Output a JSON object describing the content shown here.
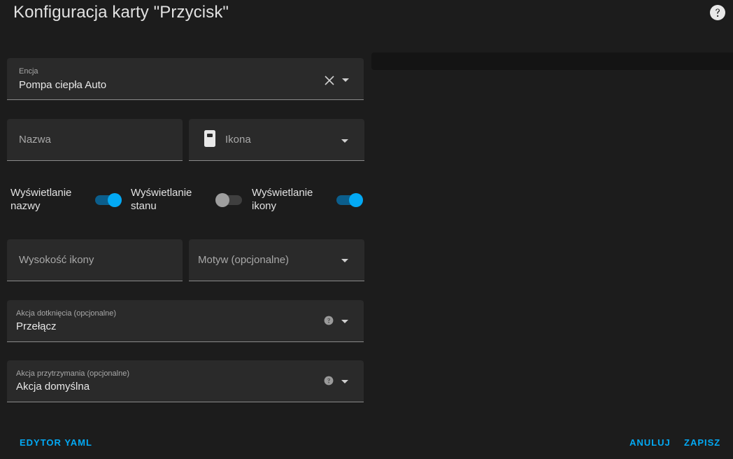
{
  "dialog": {
    "title": "Konfiguracja karty \"Przycisk\"",
    "help_icon": "help-circle-icon"
  },
  "form": {
    "entity": {
      "label": "Encja",
      "value": "Pompa ciepła Auto"
    },
    "name": {
      "placeholder": "Nazwa"
    },
    "icon": {
      "placeholder": "Ikona",
      "icon": "device-icon"
    },
    "toggles": [
      {
        "label": "Wyświetlanie nazwy",
        "on": true
      },
      {
        "label": "Wyświetlanie stanu",
        "on": false
      },
      {
        "label": "Wyświetlanie ikony",
        "on": true
      }
    ],
    "icon_height": {
      "placeholder": "Wysokość ikony"
    },
    "theme": {
      "placeholder": "Motyw (opcjonalne)"
    },
    "tap_action": {
      "label": "Akcja dotknięcia (opcjonalne)",
      "value": "Przełącz"
    },
    "hold_action": {
      "label": "Akcja przytrzymania (opcjonalne)",
      "value": "Akcja domyślna"
    }
  },
  "footer": {
    "yaml_editor": "EDYTOR YAML",
    "cancel": "ANULUJ",
    "save": "ZAPISZ"
  },
  "colors": {
    "accent": "#03a9f4",
    "background": "#1c1c1c",
    "field": "#2a2a2a"
  }
}
